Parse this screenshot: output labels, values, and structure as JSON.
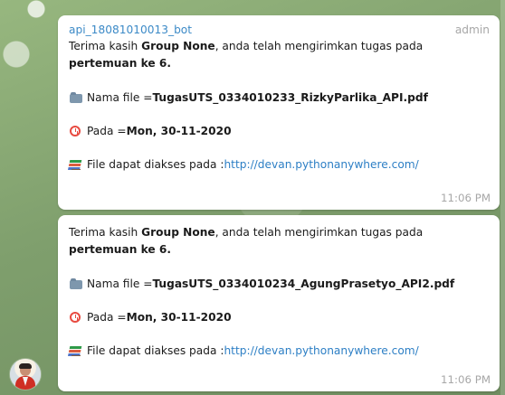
{
  "messages": [
    {
      "sender": "api_18081010013_bot",
      "role": "admin",
      "line1_prefix": "Terima kasih ",
      "group": "Group None",
      "line1_suffix": ", anda telah mengirimkan tugas pada",
      "meeting": "pertemuan ke 6.",
      "file_label": "Nama file = ",
      "file_name": "TugasUTS_0334010233_RizkyParlika_API.pdf",
      "date_label": "Pada = ",
      "date_value": "Mon, 30-11-2020",
      "link_label": "File dapat diakses pada : ",
      "link_url": "http://devan.pythonanywhere.com/",
      "time": "11:06 PM",
      "icons": [
        "folder-icon",
        "alarm-clock-icon",
        "books-icon"
      ]
    },
    {
      "line1_prefix": "Terima kasih ",
      "group": "Group None",
      "line1_suffix": ", anda telah mengirimkan tugas pada",
      "meeting": "pertemuan ke 6.",
      "file_label": "Nama file = ",
      "file_name": "TugasUTS_0334010234_AgungPrasetyo_API2.pdf",
      "date_label": "Pada = ",
      "date_value": "Mon, 30-11-2020",
      "link_label": "File dapat diakses pada : ",
      "link_url": "http://devan.pythonanywhere.com/",
      "time": "11:06 PM",
      "icons": [
        "folder-icon",
        "alarm-clock-icon",
        "books-icon"
      ]
    }
  ],
  "colors": {
    "background": "#8fae79",
    "bubble": "#ffffff",
    "sender": "#3c8ac7",
    "link": "#2d7fc5",
    "meta": "#a7a7a7"
  }
}
